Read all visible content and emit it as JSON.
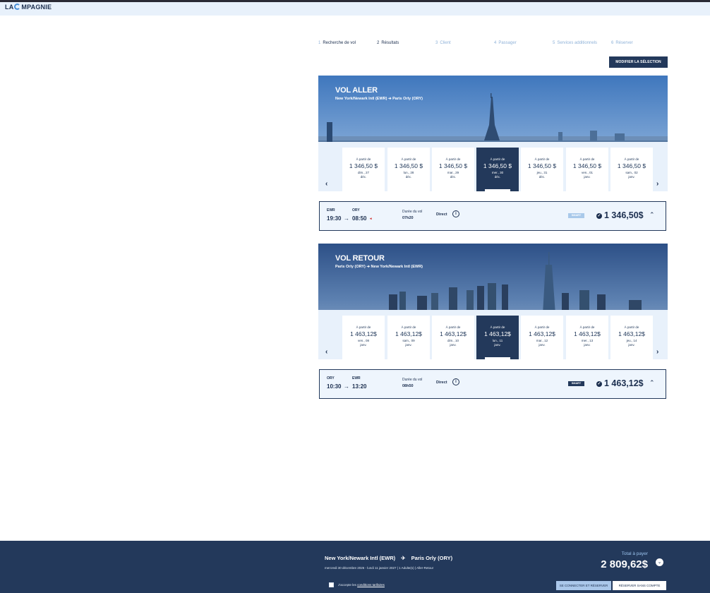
{
  "brand": {
    "logo_left": "LA",
    "logo_right": "MPAGNIE"
  },
  "steps": [
    {
      "num": "1",
      "label": "Recherche de vol"
    },
    {
      "num": "2",
      "label": "Résultats"
    },
    {
      "num": "3",
      "label": "Client"
    },
    {
      "num": "4",
      "label": "Passager"
    },
    {
      "num": "5",
      "label": "Services additionnels"
    },
    {
      "num": "6",
      "label": "Réserver"
    }
  ],
  "modify_button": "MODIFIER LA SÉLECTION",
  "outbound": {
    "title": "VOL ALLER",
    "route": "New York/Newark Intl (EWR) ➔ Paris Orly (ORY)",
    "dates": [
      {
        "from": "À partir de",
        "price": "1 346,50 $",
        "day": "dim., 27",
        "month": "déc."
      },
      {
        "from": "À partir de",
        "price": "1 346,50 $",
        "day": "lun., 28",
        "month": "déc."
      },
      {
        "from": "À partir de",
        "price": "1 346,50 $",
        "day": "mar., 29",
        "month": "déc."
      },
      {
        "from": "À partir de",
        "price": "1 346,50 $",
        "day": "mer., 30",
        "month": "déc."
      },
      {
        "from": "À partir de",
        "price": "1 346,50 $",
        "day": "jeu., 31",
        "month": "déc."
      },
      {
        "from": "À partir de",
        "price": "1 346,50 $",
        "day": "ven., 01",
        "month": "janv."
      },
      {
        "from": "À partir de",
        "price": "1 346,50 $",
        "day": "sam., 02",
        "month": "janv."
      }
    ],
    "summary": {
      "dep_code": "EWR",
      "arr_code": "ORY",
      "dep_time": "19:30",
      "arr_time": "08:50",
      "duration_label": "Durée du vol",
      "duration": "07h20",
      "direct": "Direct",
      "fare": "SMART",
      "price": "1 346,50$"
    }
  },
  "return": {
    "title": "VOL RETOUR",
    "route": "Paris Orly (ORY) ➔ New York/Newark Intl (EWR)",
    "dates": [
      {
        "from": "À partir de",
        "price": "1 463,12$",
        "day": "ven., 08",
        "month": "janv."
      },
      {
        "from": "À partir de",
        "price": "1 463,12$",
        "day": "sam., 09",
        "month": "janv."
      },
      {
        "from": "À partir de",
        "price": "1 463,12$",
        "day": "dim., 10",
        "month": "janv."
      },
      {
        "from": "À partir de",
        "price": "1 463,12$",
        "day": "lun., 11",
        "month": "janv."
      },
      {
        "from": "À partir de",
        "price": "1 463,12$",
        "day": "mar., 12",
        "month": "janv."
      },
      {
        "from": "À partir de",
        "price": "1 463,12$",
        "day": "mer., 13",
        "month": "janv."
      },
      {
        "from": "À partir de",
        "price": "1 463,12$",
        "day": "jeu., 14",
        "month": "janv."
      }
    ],
    "summary": {
      "dep_code": "ORY",
      "arr_code": "EWR",
      "dep_time": "10:30",
      "arr_time": "13:20",
      "duration_label": "Durée du vol",
      "duration": "08h50",
      "direct": "Direct",
      "fare": "SMART",
      "price": "1 463,12$"
    }
  },
  "footer": {
    "origin": "New York/Newark Intl (EWR)",
    "destination": "Paris Orly (ORY)",
    "details": "mercredi 30 décembre 2026 - lundi 11 janvier 2027  |  1 Adulte(s)  |  Aller-Retour",
    "total_label": "Total à payer",
    "total": "2 809,62$",
    "accept_prefix": "J'accepte les",
    "accept_link": "conditions tarifaires",
    "login_button": "SE CONNECTER ET RÉSERVER",
    "guest_button": "RÉSERVER SANS COMPTE"
  },
  "colors": {
    "navy": "#23395b",
    "light_panel": "#e8f1fb",
    "smart_out": "#a9c9ea",
    "smart_ret": "#23395b"
  }
}
